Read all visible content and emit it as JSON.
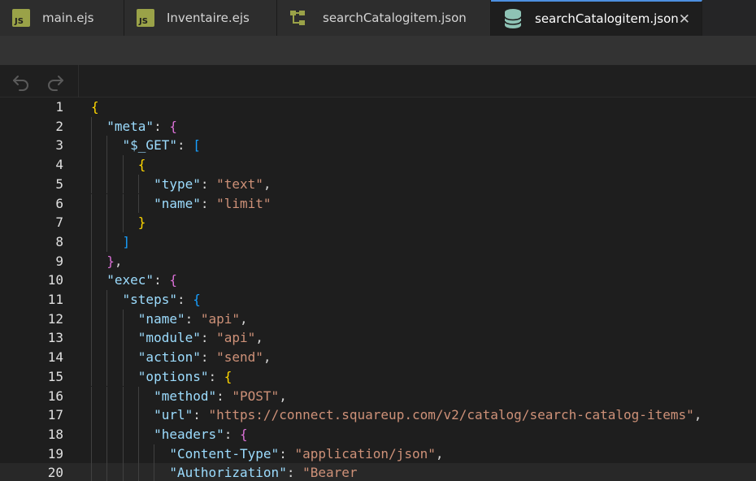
{
  "tabs": [
    {
      "label": "main.ejs",
      "icon": "js-file-icon",
      "icon_text": "JS",
      "width": 153
    },
    {
      "label": "Inventaire.ejs",
      "icon": "js-file-icon",
      "icon_text": "JS",
      "width": 188
    },
    {
      "label": "searchCatalogitem.json",
      "icon": "flow-diagram-icon",
      "width": 263
    },
    {
      "label": "searchCatalogitem.json",
      "icon": "database-icon",
      "close": "✕",
      "active": true,
      "width": 260
    }
  ],
  "editor": {
    "current_line": 20,
    "lines": [
      {
        "n": "1",
        "t": [
          [
            "{",
            "b1"
          ]
        ]
      },
      {
        "n": "2",
        "t": [
          [
            "  "
          ],
          [
            "\"meta\"",
            "k"
          ],
          [
            ": ",
            "p"
          ],
          [
            "{",
            "b2"
          ]
        ]
      },
      {
        "n": "3",
        "t": [
          [
            "    "
          ],
          [
            "\"$_GET\"",
            "k"
          ],
          [
            ": ",
            "p"
          ],
          [
            "[",
            "b3"
          ]
        ]
      },
      {
        "n": "4",
        "t": [
          [
            "      "
          ],
          [
            "{",
            "b1"
          ]
        ]
      },
      {
        "n": "5",
        "t": [
          [
            "        "
          ],
          [
            "\"type\"",
            "k"
          ],
          [
            ": ",
            "p"
          ],
          [
            "\"text\"",
            "s"
          ],
          [
            ",",
            "p"
          ]
        ]
      },
      {
        "n": "6",
        "t": [
          [
            "        "
          ],
          [
            "\"name\"",
            "k"
          ],
          [
            ": ",
            "p"
          ],
          [
            "\"limit\"",
            "s"
          ]
        ]
      },
      {
        "n": "7",
        "t": [
          [
            "      "
          ],
          [
            "}",
            "b1"
          ]
        ]
      },
      {
        "n": "8",
        "t": [
          [
            "    "
          ],
          [
            "]",
            "b3"
          ]
        ]
      },
      {
        "n": "9",
        "t": [
          [
            "  "
          ],
          [
            "}",
            "b2"
          ],
          [
            ",",
            "p"
          ]
        ]
      },
      {
        "n": "10",
        "t": [
          [
            "  "
          ],
          [
            "\"exec\"",
            "k"
          ],
          [
            ": ",
            "p"
          ],
          [
            "{",
            "b2"
          ]
        ]
      },
      {
        "n": "11",
        "t": [
          [
            "    "
          ],
          [
            "\"steps\"",
            "k"
          ],
          [
            ": ",
            "p"
          ],
          [
            "{",
            "b3"
          ]
        ]
      },
      {
        "n": "12",
        "t": [
          [
            "      "
          ],
          [
            "\"name\"",
            "k"
          ],
          [
            ": ",
            "p"
          ],
          [
            "\"api\"",
            "s"
          ],
          [
            ",",
            "p"
          ]
        ]
      },
      {
        "n": "13",
        "t": [
          [
            "      "
          ],
          [
            "\"module\"",
            "k"
          ],
          [
            ": ",
            "p"
          ],
          [
            "\"api\"",
            "s"
          ],
          [
            ",",
            "p"
          ]
        ]
      },
      {
        "n": "14",
        "t": [
          [
            "      "
          ],
          [
            "\"action\"",
            "k"
          ],
          [
            ": ",
            "p"
          ],
          [
            "\"send\"",
            "s"
          ],
          [
            ",",
            "p"
          ]
        ]
      },
      {
        "n": "15",
        "t": [
          [
            "      "
          ],
          [
            "\"options\"",
            "k"
          ],
          [
            ": ",
            "p"
          ],
          [
            "{",
            "b1"
          ]
        ]
      },
      {
        "n": "16",
        "t": [
          [
            "        "
          ],
          [
            "\"method\"",
            "k"
          ],
          [
            ": ",
            "p"
          ],
          [
            "\"POST\"",
            "s"
          ],
          [
            ",",
            "p"
          ]
        ]
      },
      {
        "n": "17",
        "t": [
          [
            "        "
          ],
          [
            "\"url\"",
            "k"
          ],
          [
            ": ",
            "p"
          ],
          [
            "\"https://connect.squareup.com/v2/catalog/search-catalog-items\"",
            "s"
          ],
          [
            ",",
            "p"
          ]
        ]
      },
      {
        "n": "18",
        "t": [
          [
            "        "
          ],
          [
            "\"headers\"",
            "k"
          ],
          [
            ": ",
            "p"
          ],
          [
            "{",
            "b2"
          ]
        ]
      },
      {
        "n": "19",
        "t": [
          [
            "          "
          ],
          [
            "\"Content-Type\"",
            "k"
          ],
          [
            ": ",
            "p"
          ],
          [
            "\"application/json\"",
            "s"
          ],
          [
            ",",
            "p"
          ]
        ]
      },
      {
        "n": "20",
        "t": [
          [
            "          "
          ],
          [
            "\"Authorization\"",
            "k"
          ],
          [
            ": ",
            "p"
          ],
          [
            "\"Bearer",
            "s"
          ]
        ]
      }
    ]
  }
}
